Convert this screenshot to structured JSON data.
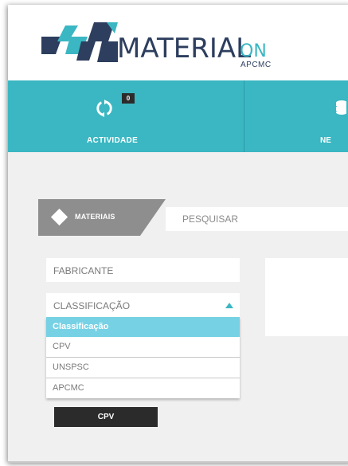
{
  "header": {
    "logo_main": "MATERIAL",
    "logo_on": "ON",
    "logo_sub": "APCMC",
    "logo_colors": {
      "navy": "#2d3e5e",
      "teal": "#3ab7c2"
    }
  },
  "nav": {
    "items": [
      {
        "label": "ACTIVIDADE",
        "badge": "0",
        "icon": "refresh-icon"
      },
      {
        "label": "NE",
        "icon": "stack-icon"
      }
    ],
    "color": "#3ab7c2"
  },
  "tabs": {
    "materials_label": "MATERIAIS",
    "materials_icon": "diamond-icon"
  },
  "search": {
    "placeholder": "PESQUISAR"
  },
  "filters": {
    "fabricante_label": "FABRICANTE",
    "classificacao_label": "CLASSIFICAÇÃO"
  },
  "dropdown": {
    "options": [
      "Classificação",
      "CPV",
      "UNSPSC",
      "APCMC"
    ],
    "selected_color": "#76d1e4"
  },
  "button": {
    "cpv_label": "CPV"
  }
}
